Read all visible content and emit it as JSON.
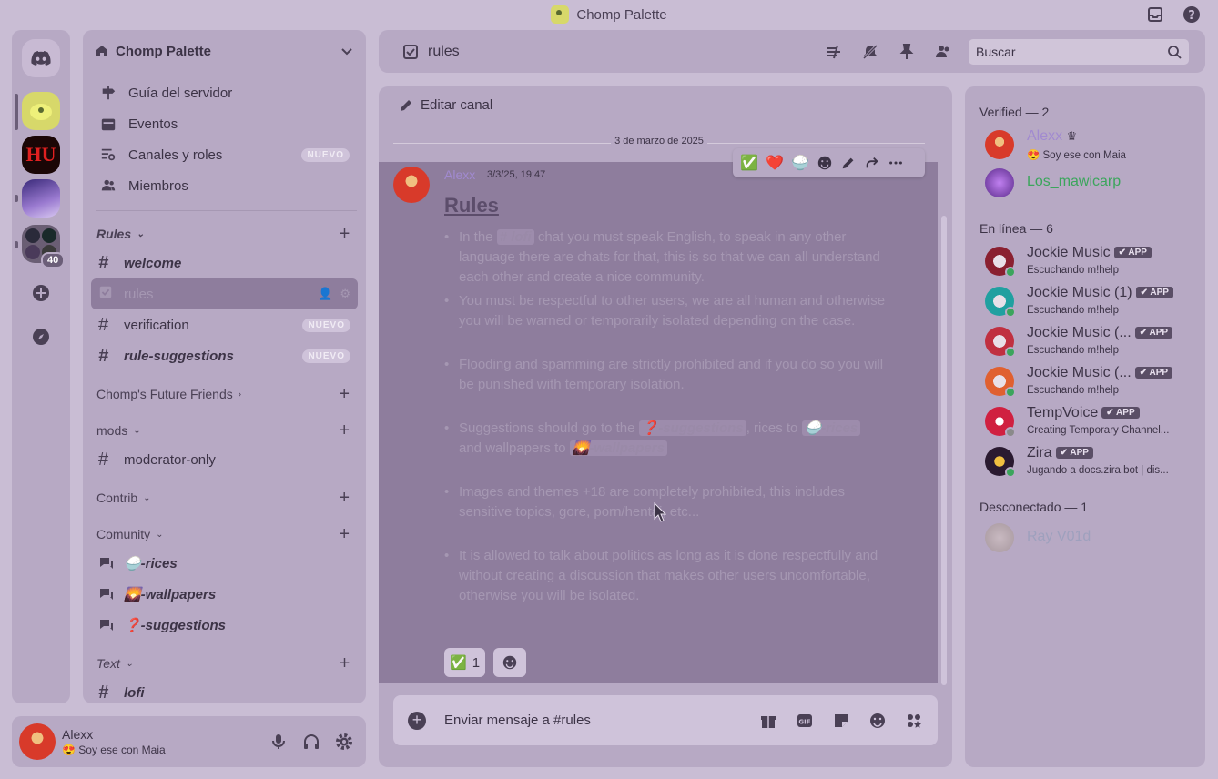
{
  "window": {
    "title": "Chomp Palette"
  },
  "servers": {
    "overflow_count": "40"
  },
  "sidebar": {
    "guild_name": "Chomp Palette",
    "nav": [
      {
        "label": "Guía del servidor"
      },
      {
        "label": "Eventos"
      },
      {
        "label": "Canales y roles",
        "badge": "NUEVO"
      },
      {
        "label": "Miembros"
      }
    ],
    "categories": {
      "rules": "Rules",
      "future": "Chomp's Future Friends",
      "mods": "mods",
      "contrib": "Contrib",
      "comunity": "Comunity",
      "text": "Text"
    },
    "channels": {
      "welcome": "welcome",
      "rules": "rules",
      "verification": "verification",
      "verification_badge": "NUEVO",
      "rule_suggestions": "rule-suggestions",
      "rule_suggestions_badge": "NUEVO",
      "moderator_only": "moderator-only",
      "rices": "🍚-rices",
      "wallpapers": "🌄-wallpapers",
      "suggestions": "❓-suggestions",
      "lofi": "lofi"
    }
  },
  "user": {
    "name": "Alexx",
    "status": "😍 Soy ese con Maia"
  },
  "topbar": {
    "channel": "rules",
    "search_placeholder": "Buscar"
  },
  "chat": {
    "edit_channel": "Editar canal",
    "date": "3 de marzo de 2025",
    "message": {
      "author": "Alexx",
      "time": "3/3/25, 19:47",
      "title": "Rules",
      "r1_a": "In the ",
      "r1_mention": "# lofi",
      "r1_b": " chat you must speak English, to speak in any other language there are chats for that, this is so that we can all understand each other and create a nice community.",
      "r2": "You must be respectful to other users, we are all human and otherwise you will be warned or temporarily isolated depending on the case.",
      "r3": "Flooding and spamming are strictly prohibited and if you do so you will be punished with temporary isolation.",
      "r4_a": "Suggestions should go to the ",
      "r4_m1": "❓-suggestions",
      "r4_b": ", rices to ",
      "r4_m2": "🍚-rices",
      "r4_c": " and wallpapers to ",
      "r4_m3": "🌄-wallpapers",
      "r5": "Images and themes +18 are completely prohibited, this includes sensitive topics, gore, porn/hentai, etc...",
      "r6": "It is allowed to talk about politics as long as it is done respectfully and without creating a discussion that makes other users uncomfortable, otherwise you will be isolated.",
      "reaction_emoji": "✅",
      "reaction_count": "1"
    },
    "hover_reactions": [
      "✅",
      "❤️",
      "🍚"
    ],
    "composer_placeholder": "Enviar mensaje a #rules"
  },
  "members": {
    "verified_header": "Verified — 2",
    "online_header": "En línea — 6",
    "offline_header": "Desconectado — 1",
    "list": [
      {
        "name": "Alexx",
        "status": "😍 Soy ese con Maia"
      },
      {
        "name": "Los_mawicarp",
        "status": ""
      },
      {
        "name": "Jockie Music",
        "tag": "✔ APP",
        "status": "Escuchando m!help"
      },
      {
        "name": "Jockie Music (1)",
        "tag": "✔ APP",
        "status": "Escuchando m!help"
      },
      {
        "name": "Jockie Music (...",
        "tag": "✔ APP",
        "status": "Escuchando m!help"
      },
      {
        "name": "Jockie Music (...",
        "tag": "✔ APP",
        "status": "Escuchando m!help"
      },
      {
        "name": "TempVoice",
        "tag": "✔ APP",
        "status": "Creating Temporary Channel..."
      },
      {
        "name": "Zira",
        "tag": "✔ APP",
        "status": "Jugando a docs.zira.bot | dis..."
      },
      {
        "name": "Ray V01d",
        "status": ""
      }
    ]
  },
  "colors": {
    "background": "#c9bdd4",
    "panel": "#b7a9c4",
    "highlight": "#8e7d9d",
    "author": "#a18ad0",
    "online": "#3ba55c",
    "mawicarp": "#3ba55c"
  }
}
